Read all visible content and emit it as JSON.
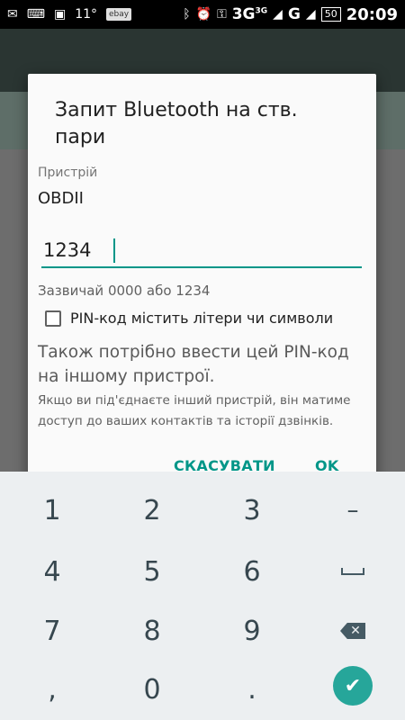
{
  "status_bar": {
    "temperature": "11°",
    "ebay_badge": "ebay",
    "network": "3G",
    "network_sup": "3G",
    "network2": "G",
    "battery": "50",
    "time": "20:09",
    "icons": [
      "notification-icon",
      "keyboard-icon",
      "image-icon",
      "bluetooth-icon",
      "alarm-icon",
      "key-icon",
      "signal-icon"
    ]
  },
  "dialog": {
    "title": "Запит Bluetooth на ств. пари",
    "device_label": "Пристрій",
    "device_name": "OBDII",
    "pin_value": "1234",
    "hint": "Зазвичай 0000 або 1234",
    "checkbox_label": "PIN-код містить літери чи символи",
    "checkbox_checked": false,
    "also_text": "Також потрібно ввести цей PIN-код на іншому пристрої.",
    "access_text": "Якщо ви під'єднаєте інший пристрій, він матиме доступ до ваших контактів та історії дзвінків.",
    "cancel_label": "СКАСУВАТИ",
    "ok_label": "OK"
  },
  "keypad": {
    "row1": [
      "1",
      "2",
      "3",
      "–"
    ],
    "row2": [
      "4",
      "5",
      "6"
    ],
    "row3": [
      "7",
      "8",
      "9"
    ],
    "row4": [
      ",",
      "0",
      "."
    ],
    "accent_color": "#26a69a"
  },
  "colors": {
    "accent": "#009688",
    "keypad_bg": "#eceff1",
    "toolbar": "#2a3532"
  }
}
